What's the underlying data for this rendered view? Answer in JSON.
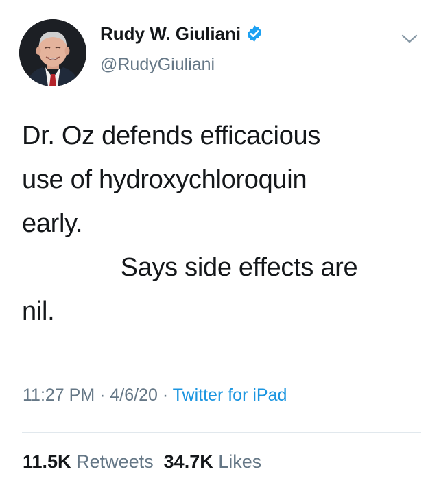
{
  "author": {
    "display_name": "Rudy W. Giuliani",
    "handle": "@RudyGiuliani",
    "verified": true
  },
  "tweet": {
    "lines": [
      "Dr. Oz defends efficacious",
      "use of hydroxychloroquin",
      "early.",
      "              Says side effects are",
      "nil."
    ]
  },
  "meta": {
    "time": "11:27 PM",
    "date": "4/6/20",
    "separator": " · ",
    "source": "Twitter for iPad"
  },
  "stats": {
    "retweets_count": "11.5K",
    "retweets_label": "Retweets",
    "likes_count": "34.7K",
    "likes_label": "Likes"
  },
  "icons": {
    "verified": "verified-badge-icon",
    "menu": "chevron-down-icon"
  },
  "colors": {
    "text": "#14171a",
    "secondary": "#657786",
    "link": "#1b95e0",
    "verified": "#1da1f2",
    "divider": "#e1e8ed"
  }
}
